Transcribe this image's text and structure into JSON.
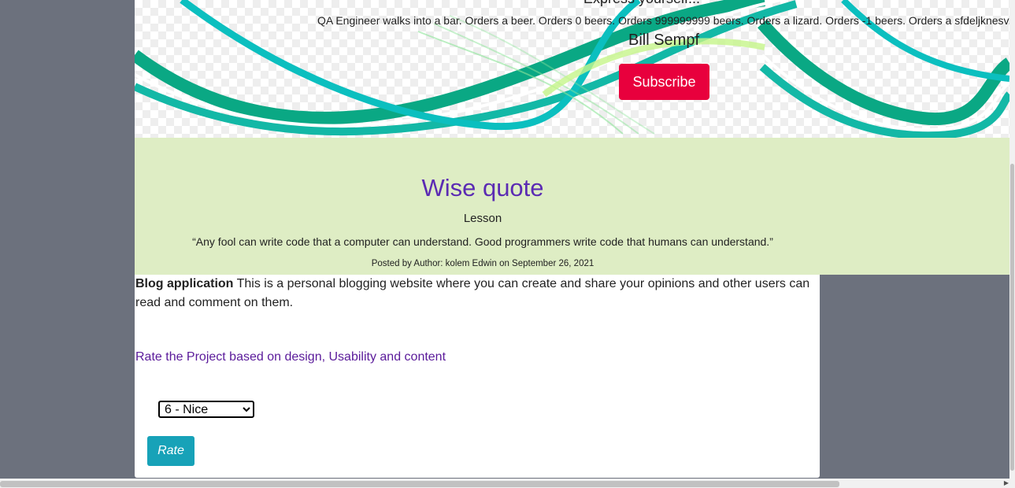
{
  "banner": {
    "tagline": "Express yourself...",
    "joke": "QA Engineer walks into a bar. Orders a beer. Orders 0 beers. Orders 999999999 beers. Orders a lizard. Orders -1 beers. Orders a sfdeljknesv.",
    "author": "Bill Sempf",
    "subscribe_label": "Subscribe",
    "subscribe_color": "#e8003d"
  },
  "quote": {
    "title": "Wise quote",
    "category": "Lesson",
    "text": "“Any fool can write code that a computer can understand. Good programmers write code that humans can understand.”",
    "meta": "Posted by Author: kolem Edwin on September 26, 2021"
  },
  "project": {
    "name": "Blog application",
    "description": " This is a personal blogging website where you can create and share your opinions and other users can read and comment on them.",
    "rate_prompt": "Rate the Project based on design, Usability and content",
    "rating_selected": "6 - Nice",
    "rate_label": "Rate"
  },
  "colors": {
    "page_bg": "#6c717d",
    "quote_bg": "#deedc4",
    "title_purple": "#5b2bb3",
    "rate_button": "#17a2b8"
  }
}
